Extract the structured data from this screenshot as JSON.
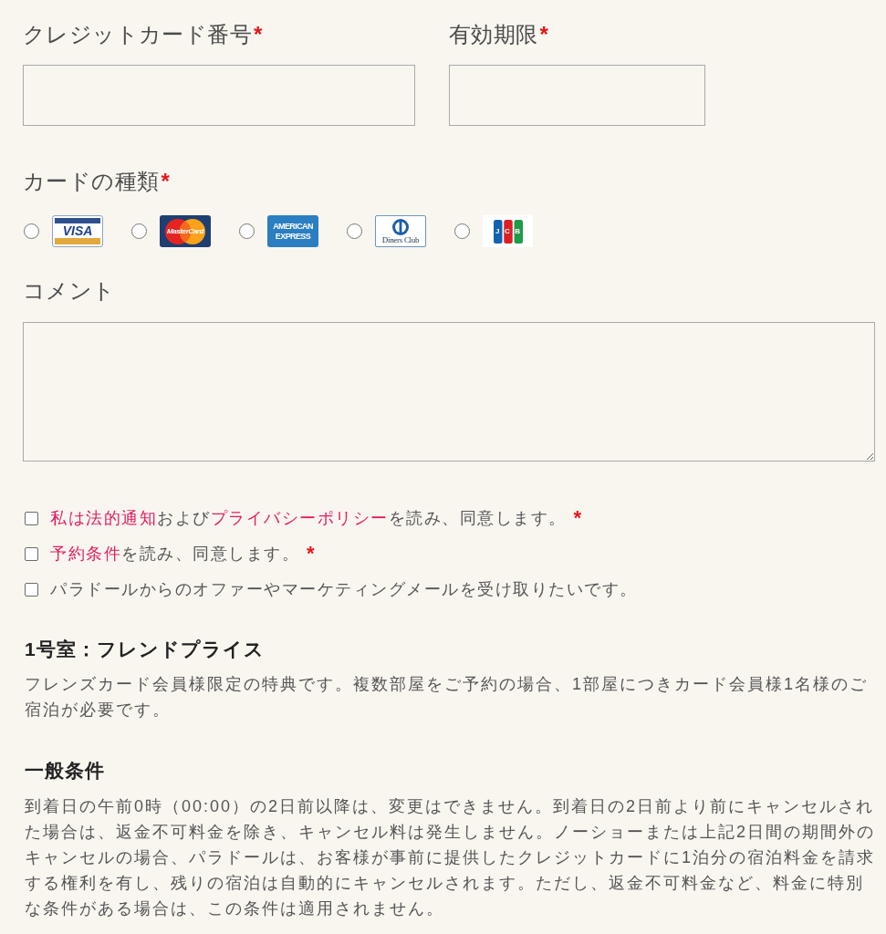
{
  "payment_fields": [
    {
      "label": "クレジットカード番号",
      "required_mark": "*"
    },
    {
      "label": "有効期限",
      "required_mark": "*"
    }
  ],
  "card_type": {
    "label": "カードの種類",
    "required_mark": "*",
    "options": [
      {
        "kind": "visa",
        "logo_lines": [
          "VISA"
        ],
        "selected": false
      },
      {
        "kind": "mastercard",
        "logo_lines": [
          "MasterCard"
        ],
        "selected": false
      },
      {
        "kind": "amex",
        "logo_lines": [
          "AMERICAN",
          "EXPRESS"
        ],
        "selected": false
      },
      {
        "kind": "diners",
        "logo_lines": [
          "Diners Club"
        ],
        "selected": false
      },
      {
        "kind": "jcb",
        "logo_lines": [
          "JCB"
        ],
        "selected": false
      }
    ]
  },
  "comment": {
    "label": "コメント"
  },
  "consents": [
    {
      "parts": [
        {
          "kind": "link",
          "text": "私は法的通知"
        },
        {
          "kind": "plain",
          "text": "および"
        },
        {
          "kind": "link",
          "text": "プライバシーポリシー"
        },
        {
          "kind": "plain",
          "text": "を読み、同意します。"
        }
      ],
      "required_mark": "*",
      "checked": false
    },
    {
      "parts": [
        {
          "kind": "link",
          "text": "予約条件"
        },
        {
          "kind": "plain",
          "text": "を読み、同意します。"
        }
      ],
      "required_mark": "*",
      "checked": false
    },
    {
      "parts": [
        {
          "kind": "plain",
          "text": "パラドールからのオファーやマーケティングメールを受け取りたいです。"
        }
      ],
      "checked": false
    }
  ],
  "sections": [
    {
      "title": "1号室：フレンドプライス",
      "text": "フレンズカード会員様限定の特典です。複数部屋をご予約の場合、1部屋につきカード会員様1名様のご宿泊が必要です。"
    },
    {
      "title": "一般条件",
      "text": "到着日の午前0時（00:00）の2日前以降は、変更はできません。到着日の2日前より前にキャンセルされた場合は、返金不可料金を除き、キャンセル料は発生しません。ノーショーまたは上記2日間の期間外のキャンセルの場合、パラドールは、お客様が事前に提供したクレジットカードに1泊分の宿泊料金を請求する権利を有し、残りの宿泊は自動的にキャンセルされます。ただし、返金不可料金など、料金に特別な条件がある場合は、この条件は適用されません。"
    }
  ]
}
